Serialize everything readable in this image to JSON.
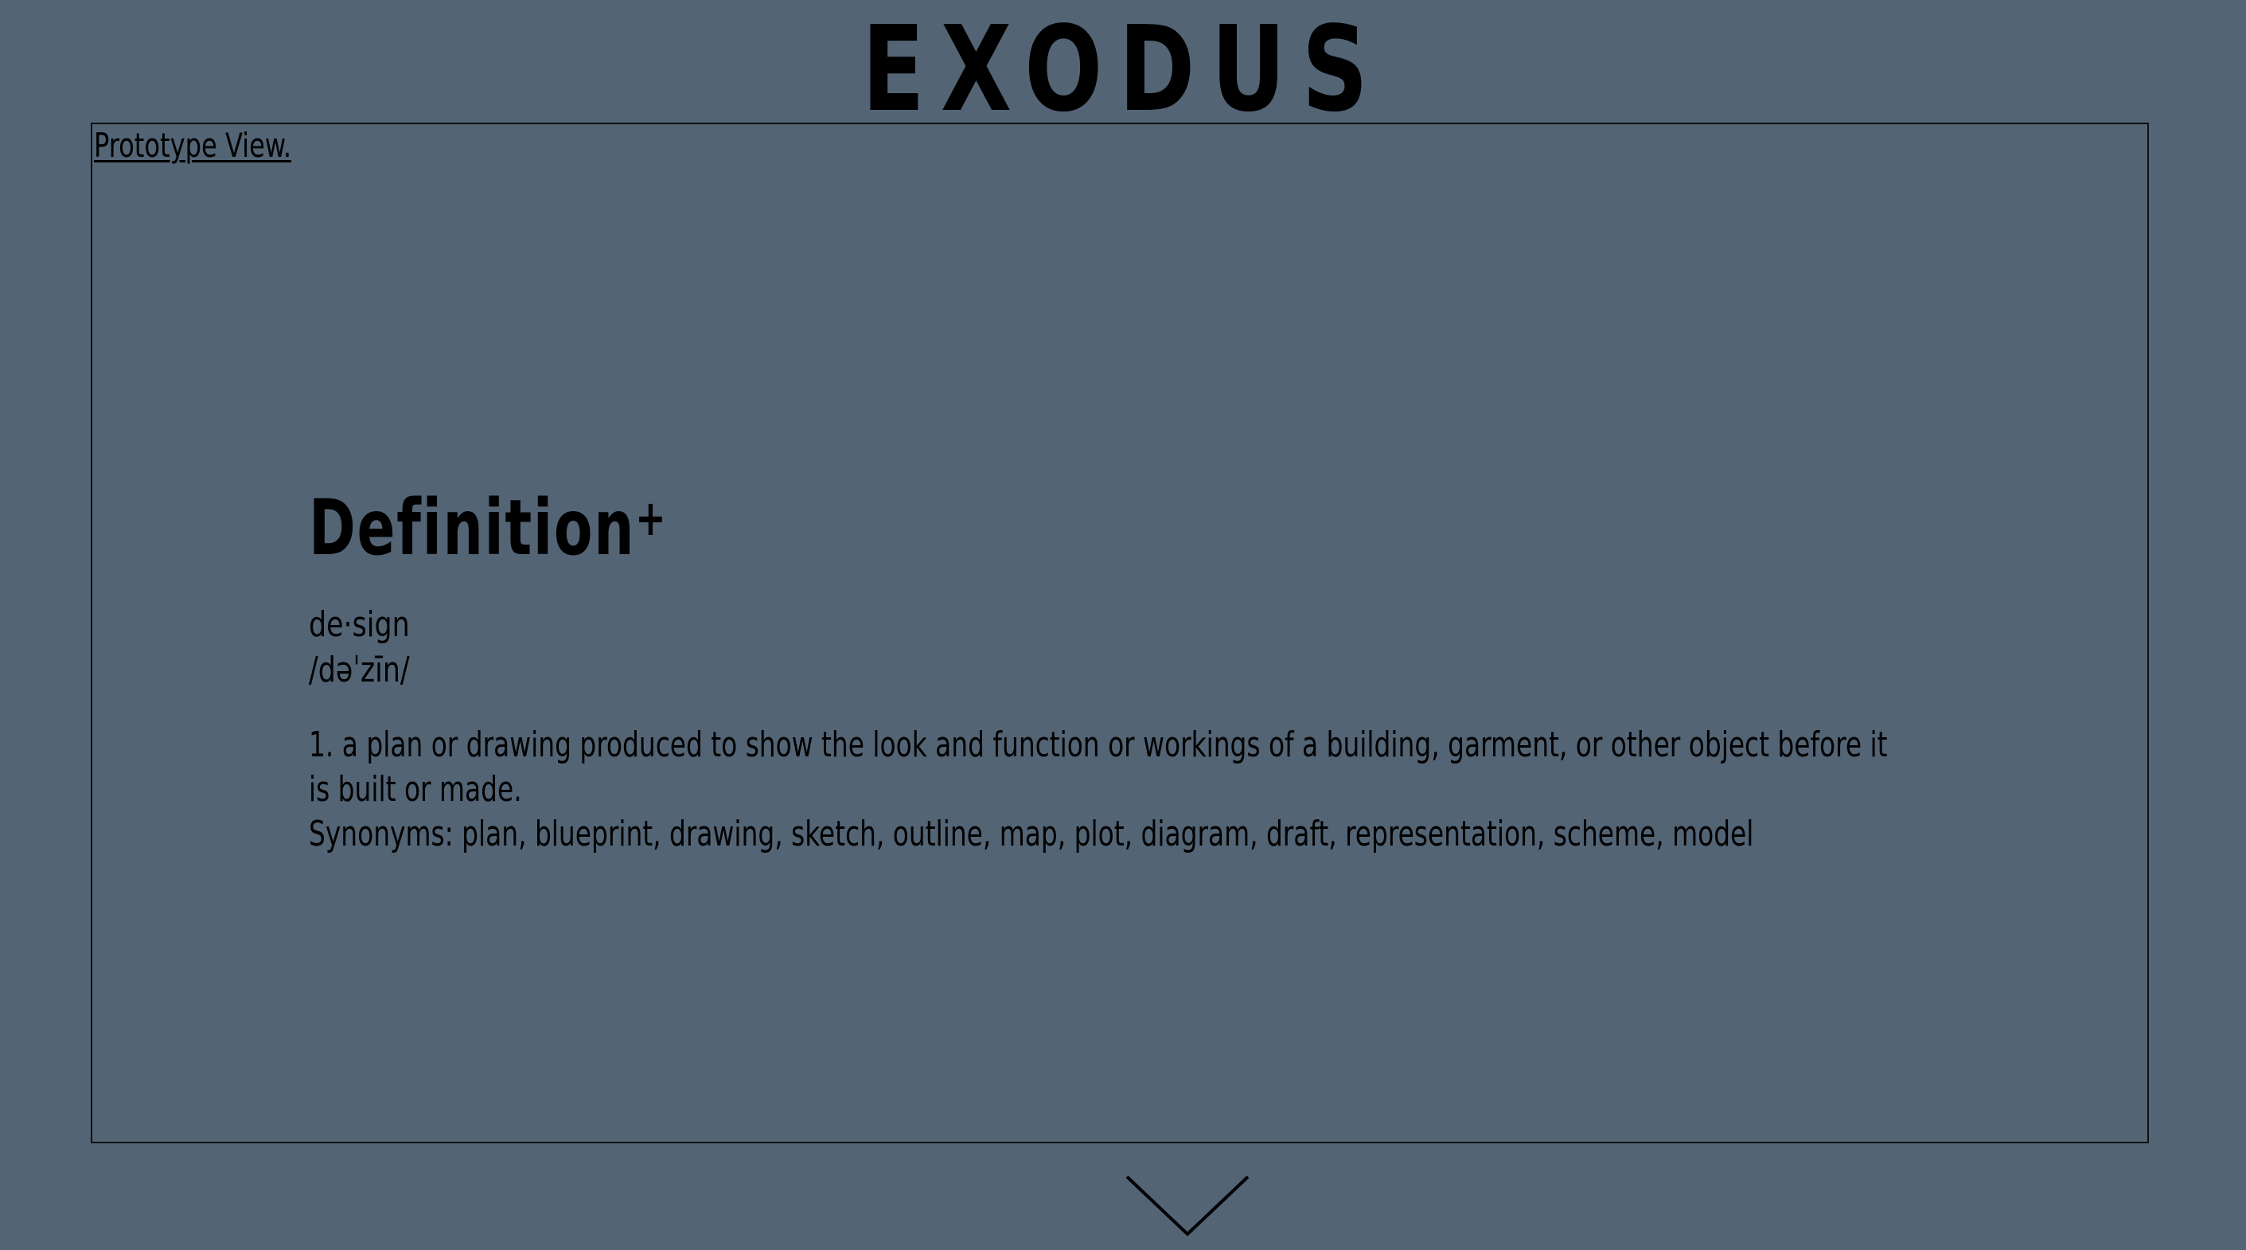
{
  "header": {
    "title": "EXODUS"
  },
  "prototype": {
    "link_label": "Prototype View."
  },
  "definition": {
    "heading": "Definition",
    "expand_symbol": "+",
    "word": "de·sign",
    "pronunciation": "/dəˈzīn/",
    "meaning": "1. a plan or drawing produced to show the look and function or workings of a building, garment, or other object before it is built or made.",
    "synonyms": "Synonyms: plan, blueprint, drawing, sketch, outline, map, plot, diagram, draft, representation, scheme, model"
  },
  "icons": {
    "scroll_down": "chevron-down-icon"
  },
  "colors": {
    "background": "#536475",
    "text": "#000000",
    "frame_border": "#111111"
  }
}
